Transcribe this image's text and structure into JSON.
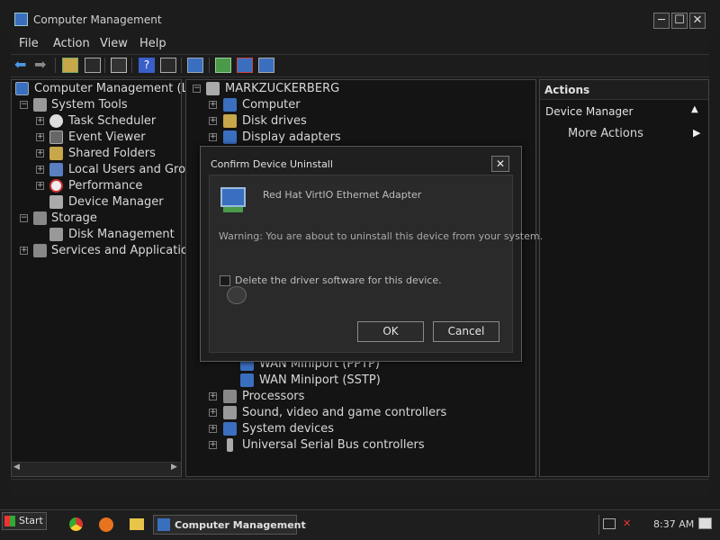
{
  "window": {
    "title": "Computer Management",
    "min": "─",
    "max": "☐",
    "close": "✕"
  },
  "menu": {
    "file": "File",
    "action": "Action",
    "view": "View",
    "help": "Help"
  },
  "left_tree": {
    "root": "Computer Management (Loc",
    "system_tools": "System Tools",
    "task_scheduler": "Task Scheduler",
    "event_viewer": "Event Viewer",
    "shared_folders": "Shared Folders",
    "local_users": "Local Users and Grou",
    "performance": "Performance",
    "device_manager": "Device Manager",
    "storage": "Storage",
    "disk_management": "Disk Management",
    "services": "Services and Application"
  },
  "device_tree": {
    "root": "MARKZUCKERBERG",
    "computer": "Computer",
    "disk_drives": "Disk drives",
    "display_adapters": "Display adapters",
    "wan_pptp": "WAN Miniport (PPTP)",
    "wan_sstp": "WAN Miniport (SSTP)",
    "processors": "Processors",
    "sound": "Sound, video and game controllers",
    "system_devices": "System devices",
    "usb": "Universal Serial Bus controllers"
  },
  "actions": {
    "header": "Actions",
    "section": "Device Manager",
    "more": "More Actions"
  },
  "dialog": {
    "title": "Confirm Device Uninstall",
    "device": "Red Hat VirtIO Ethernet Adapter",
    "warning": "Warning: You are about to uninstall this device from your system.",
    "checkbox_label": "Delete the driver software for this device.",
    "checkbox_checked": false,
    "ok": "OK",
    "cancel": "Cancel"
  },
  "taskbar": {
    "start": "Start",
    "task_label": "Computer Management",
    "clock": "8:37 AM"
  }
}
